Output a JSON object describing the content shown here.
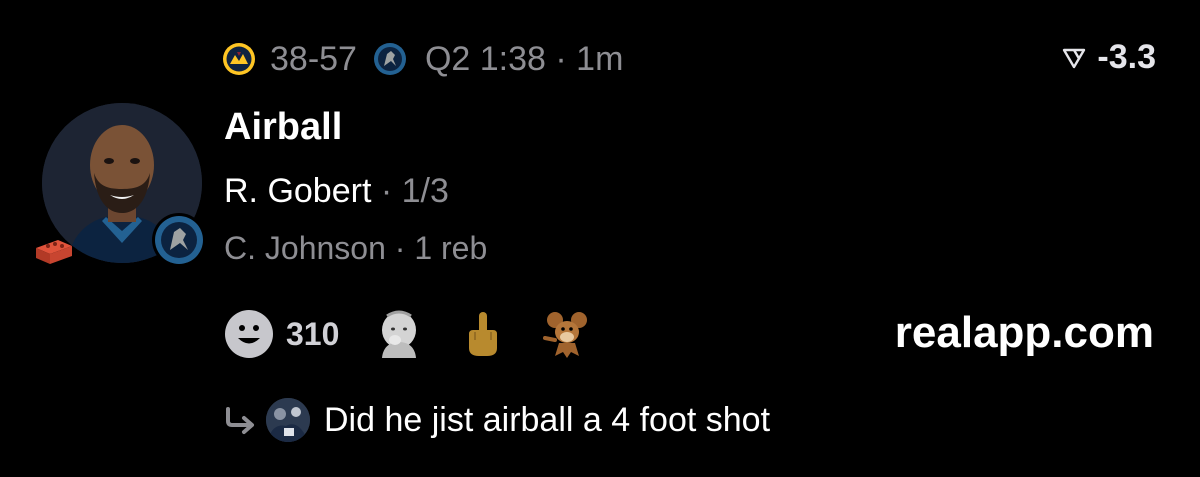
{
  "header": {
    "home_team_icon": "nuggets-logo-icon",
    "score": "38-57",
    "away_team_icon": "timberwolves-logo-icon",
    "clock": "Q2 1:38 · 1m",
    "odds_icon": "odds-tag-icon",
    "odds": "-3.3"
  },
  "player": {
    "avatar_icon": "player-headshot-icon",
    "team_badge_icon": "timberwolves-logo-icon",
    "event_badge_icon": "brick-icon"
  },
  "play": {
    "title": "Airball",
    "player_name": "R. Gobert",
    "player_stat": "· 1/3",
    "secondary_name": "C. Johnson",
    "secondary_stat": "· 1 reb"
  },
  "reactions": {
    "add_icon": "smiley-icon",
    "count": "310",
    "items": [
      {
        "icon": "baby-thinking-emoji"
      },
      {
        "icon": "middle-finger-emoji"
      },
      {
        "icon": "cartoon-mouse-emoji"
      }
    ]
  },
  "brand": "realapp.com",
  "reply": {
    "arrow_icon": "reply-arrow-icon",
    "avatar_icon": "user-avatar-icon",
    "text": "Did he jist airball a 4 foot shot"
  },
  "colors": {
    "background": "#000000",
    "text_primary": "#ffffff",
    "text_secondary": "#8e8e93",
    "nuggets_gold": "#fec524",
    "nuggets_navy": "#0e2240",
    "wolves_blue": "#236192"
  }
}
